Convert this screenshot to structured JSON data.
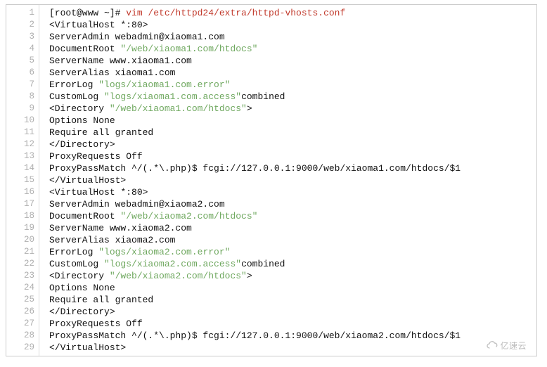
{
  "watermark": "亿速云",
  "lines": [
    {
      "segments": [
        {
          "text": "[root@www ~]# ",
          "class": "prompt-user"
        },
        {
          "text": "vim /etc/httpd24/extra/httpd-vhosts.conf",
          "class": "prompt-cmd"
        }
      ]
    },
    {
      "segments": [
        {
          "text": "<VirtualHost *:80>"
        }
      ]
    },
    {
      "segments": [
        {
          "text": "ServerAdmin webadmin@xiaoma1.com"
        }
      ]
    },
    {
      "segments": [
        {
          "text": "DocumentRoot "
        },
        {
          "text": "\"/web/xiaoma1.com/htdocs\"",
          "class": "string"
        }
      ]
    },
    {
      "segments": [
        {
          "text": "ServerName www.xiaoma1.com"
        }
      ]
    },
    {
      "segments": [
        {
          "text": "ServerAlias xiaoma1.com"
        }
      ]
    },
    {
      "segments": [
        {
          "text": "ErrorLog "
        },
        {
          "text": "\"logs/xiaoma1.com.error\"",
          "class": "string"
        }
      ]
    },
    {
      "segments": [
        {
          "text": "CustomLog "
        },
        {
          "text": "\"logs/xiaoma1.com.access\"",
          "class": "string"
        },
        {
          "text": "combined"
        }
      ]
    },
    {
      "segments": [
        {
          "text": "<Directory "
        },
        {
          "text": "\"/web/xiaoma1.com/htdocs\"",
          "class": "string"
        },
        {
          "text": ">"
        }
      ]
    },
    {
      "segments": [
        {
          "text": "Options None"
        }
      ]
    },
    {
      "segments": [
        {
          "text": "Require all granted"
        }
      ]
    },
    {
      "segments": [
        {
          "text": "</Directory>"
        }
      ]
    },
    {
      "segments": [
        {
          "text": "ProxyRequests Off"
        }
      ]
    },
    {
      "segments": [
        {
          "text": "ProxyPassMatch ^/(.*\\.php)$ fcgi://127.0.0.1:9000/web/xiaoma1.com/htdocs/$1"
        }
      ]
    },
    {
      "segments": [
        {
          "text": "</VirtualHost>"
        }
      ]
    },
    {
      "segments": [
        {
          "text": "<VirtualHost *:80>"
        }
      ]
    },
    {
      "segments": [
        {
          "text": "ServerAdmin webadmin@xiaoma2.com"
        }
      ]
    },
    {
      "segments": [
        {
          "text": "DocumentRoot "
        },
        {
          "text": "\"/web/xiaoma2.com/htdocs\"",
          "class": "string"
        }
      ]
    },
    {
      "segments": [
        {
          "text": "ServerName www.xiaoma2.com"
        }
      ]
    },
    {
      "segments": [
        {
          "text": "ServerAlias xiaoma2.com"
        }
      ]
    },
    {
      "segments": [
        {
          "text": "ErrorLog "
        },
        {
          "text": "\"logs/xiaoma2.com.error\"",
          "class": "string"
        }
      ]
    },
    {
      "segments": [
        {
          "text": "CustomLog "
        },
        {
          "text": "\"logs/xiaoma2.com.access\"",
          "class": "string"
        },
        {
          "text": "combined"
        }
      ]
    },
    {
      "segments": [
        {
          "text": "<Directory "
        },
        {
          "text": "\"/web/xiaoma2.com/htdocs\"",
          "class": "string"
        },
        {
          "text": ">"
        }
      ]
    },
    {
      "segments": [
        {
          "text": "Options None"
        }
      ]
    },
    {
      "segments": [
        {
          "text": "Require all granted"
        }
      ]
    },
    {
      "segments": [
        {
          "text": "</Directory>"
        }
      ]
    },
    {
      "segments": [
        {
          "text": "ProxyRequests Off"
        }
      ]
    },
    {
      "segments": [
        {
          "text": "ProxyPassMatch ^/(.*\\.php)$ fcgi://127.0.0.1:9000/web/xiaoma2.com/htdocs/$1"
        }
      ]
    },
    {
      "segments": [
        {
          "text": "</VirtualHost>"
        }
      ]
    }
  ]
}
